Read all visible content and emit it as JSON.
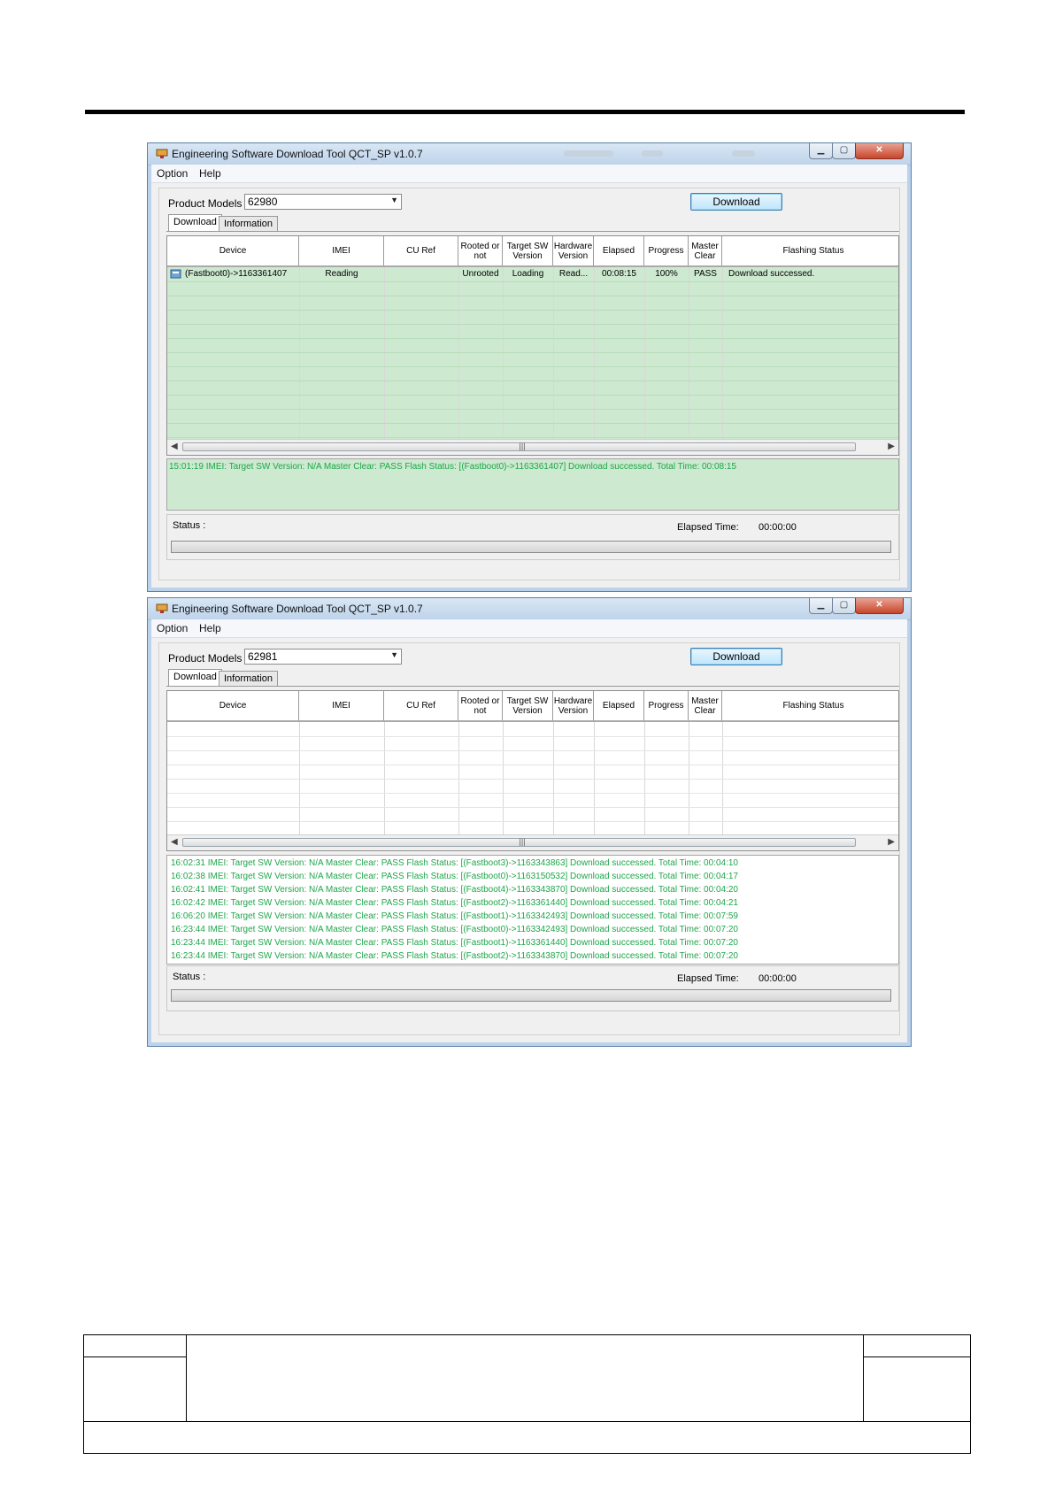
{
  "window1": {
    "title": "Engineering Software Download Tool QCT_SP v1.0.7",
    "menu": [
      "Option",
      "Help"
    ],
    "product_models_label": "Product Models :",
    "product_model_value": "62980",
    "download_button": "Download",
    "tabs": [
      "Download",
      "Information"
    ],
    "columns": [
      "Device",
      "IMEI",
      "CU Ref",
      "Rooted or not",
      "Target SW Version",
      "Hardware Version",
      "Elapsed",
      "Progress",
      "Master Clear",
      "Flashing Status"
    ],
    "row": {
      "device": "(Fastboot0)->1163361407",
      "imei": "Reading",
      "cu_ref": "",
      "rooted": "Unrooted",
      "target_sw": "Loading",
      "hardware": "Read...",
      "elapsed": "00:08:15",
      "progress": "100%",
      "master_clear": "PASS",
      "flashing_status": "Download successed."
    },
    "log": [
      "15:01:19   IMEI:    Target SW Version: N/A   Master Clear: PASS   Flash Status: [(Fastboot0)->1163361407] Download successed.    Total Time: 00:08:15"
    ],
    "status_label": "Status :",
    "elapsed_label": "Elapsed Time:",
    "elapsed_value": "00:00:00"
  },
  "window2": {
    "title": "Engineering Software Download Tool QCT_SP v1.0.7",
    "menu": [
      "Option",
      "Help"
    ],
    "product_models_label": "Product Models :",
    "product_model_value": "62981",
    "download_button": "Download",
    "tabs": [
      "Download",
      "Information"
    ],
    "columns": [
      "Device",
      "IMEI",
      "CU Ref",
      "Rooted or not",
      "Target SW Version",
      "Hardware Version",
      "Elapsed",
      "Progress",
      "Master Clear",
      "Flashing Status"
    ],
    "log": [
      "16:02:31   IMEI:    Target SW Version: N/A   Master Clear: PASS   Flash Status: [(Fastboot3)->1163343863] Download successed.    Total Time: 00:04:10",
      "16:02:38   IMEI:    Target SW Version: N/A   Master Clear: PASS   Flash Status: [(Fastboot0)->1163150532] Download successed.    Total Time: 00:04:17",
      "16:02:41   IMEI:    Target SW Version: N/A   Master Clear: PASS   Flash Status: [(Fastboot4)->1163343870] Download successed.    Total Time: 00:04:20",
      "16:02:42   IMEI:    Target SW Version: N/A   Master Clear: PASS   Flash Status: [(Fastboot2)->1163361440] Download successed.    Total Time: 00:04:21",
      "16:06:20   IMEI:    Target SW Version: N/A   Master Clear: PASS   Flash Status: [(Fastboot1)->1163342493] Download successed.    Total Time: 00:07:59",
      "16:23:44   IMEI:    Target SW Version: N/A   Master Clear: PASS   Flash Status: [(Fastboot0)->1163342493] Download successed.    Total Time: 00:07:20",
      "16:23:44   IMEI:    Target SW Version: N/A   Master Clear: PASS   Flash Status: [(Fastboot1)->1163361440] Download successed.    Total Time: 00:07:20",
      "16:23:44   IMEI:    Target SW Version: N/A   Master Clear: PASS   Flash Status: [(Fastboot2)->1163343870] Download successed.    Total Time: 00:07:20"
    ],
    "status_label": "Status :",
    "elapsed_label": "Elapsed Time:",
    "elapsed_value": "00:00:00"
  },
  "colors": {
    "grid_green": "#cde9cf",
    "log_text_green": "#1ea64a",
    "title_bar": "#bed3ea",
    "close_button": "#c8452b"
  },
  "icons": {
    "app": "download-tool-icon",
    "device_row": "device-icon"
  }
}
